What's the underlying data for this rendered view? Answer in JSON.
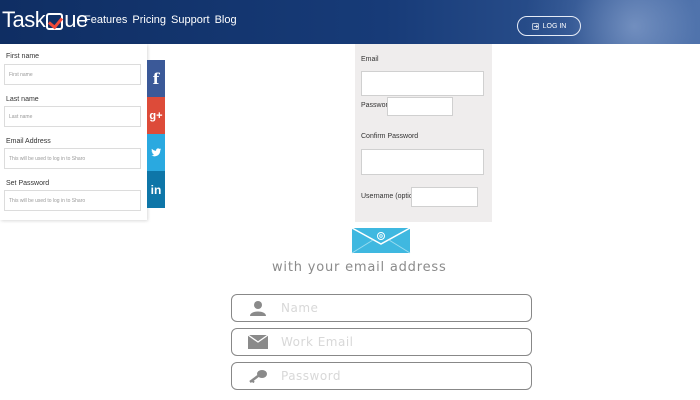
{
  "header": {
    "logo_text_left": "Task",
    "logo_text_right": "ue",
    "nav": [
      "Features",
      "Pricing",
      "Support",
      "Blog"
    ],
    "login_label": "LOG IN",
    "login_icon": "login-icon",
    "colors": {
      "bar": "#173b78",
      "logo_check": "#f04a3a"
    }
  },
  "left_form": {
    "fields": [
      {
        "label": "First name",
        "placeholder": "First name"
      },
      {
        "label": "Last name",
        "placeholder": "Last name"
      },
      {
        "label": "Email Address",
        "placeholder": "This will be used to log in to Sharo"
      },
      {
        "label": "Set Password",
        "placeholder": "This will be used to log in to Sharo"
      }
    ]
  },
  "social": [
    {
      "name": "facebook",
      "glyph": "f",
      "color": "#3b5998"
    },
    {
      "name": "google-plus",
      "glyph": "g+",
      "color": "#dd4b39"
    },
    {
      "name": "twitter",
      "glyph": "t",
      "color": "#2aa9e0"
    },
    {
      "name": "linkedin",
      "glyph": "in",
      "color": "#0e76a8"
    }
  ],
  "mid_form": {
    "email_label": "Email",
    "password_label": "Password",
    "confirm_label": "Confirm Password",
    "username_label": "Username (optional)"
  },
  "signup": {
    "heading": "with your email address",
    "name_placeholder": "Name",
    "work_email_placeholder": "Work Email",
    "password_placeholder": "Password",
    "envelope_color": "#3fb8e0"
  }
}
